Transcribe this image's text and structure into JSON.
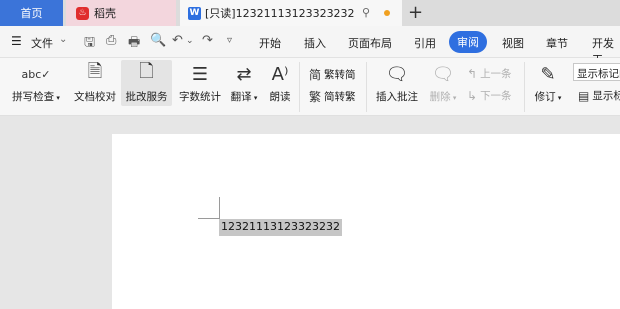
{
  "tabbar": {
    "home_label": "首页",
    "tab2_label": "稻壳",
    "tab3_label": "[只读]12321113123323232",
    "plus_label": "+"
  },
  "menubar": {
    "file_label": "文件",
    "tabs": [
      "开始",
      "插入",
      "页面布局",
      "引用",
      "审阅",
      "视图",
      "章节",
      "开发工"
    ],
    "active_tab": "审阅"
  },
  "ribbon": {
    "spell_check": "拼写检查",
    "doc_proof": "文档校对",
    "review_service": "批改服务",
    "word_count": "字数统计",
    "translate": "翻译",
    "read_aloud": "朗读",
    "trad_to_simp": "繁转简",
    "simp_to_trad": "简转繁",
    "insert_comment": "插入批注",
    "delete": "删除",
    "prev": "上一条",
    "next": "下一条",
    "track_changes": "修订",
    "show_markup": "显示标记的",
    "show_markup2": "显示标"
  },
  "document": {
    "selected_text": "12321113123323232"
  },
  "colors": {
    "accent": "#2f6fe0",
    "home_tab": "#3b74d9"
  }
}
